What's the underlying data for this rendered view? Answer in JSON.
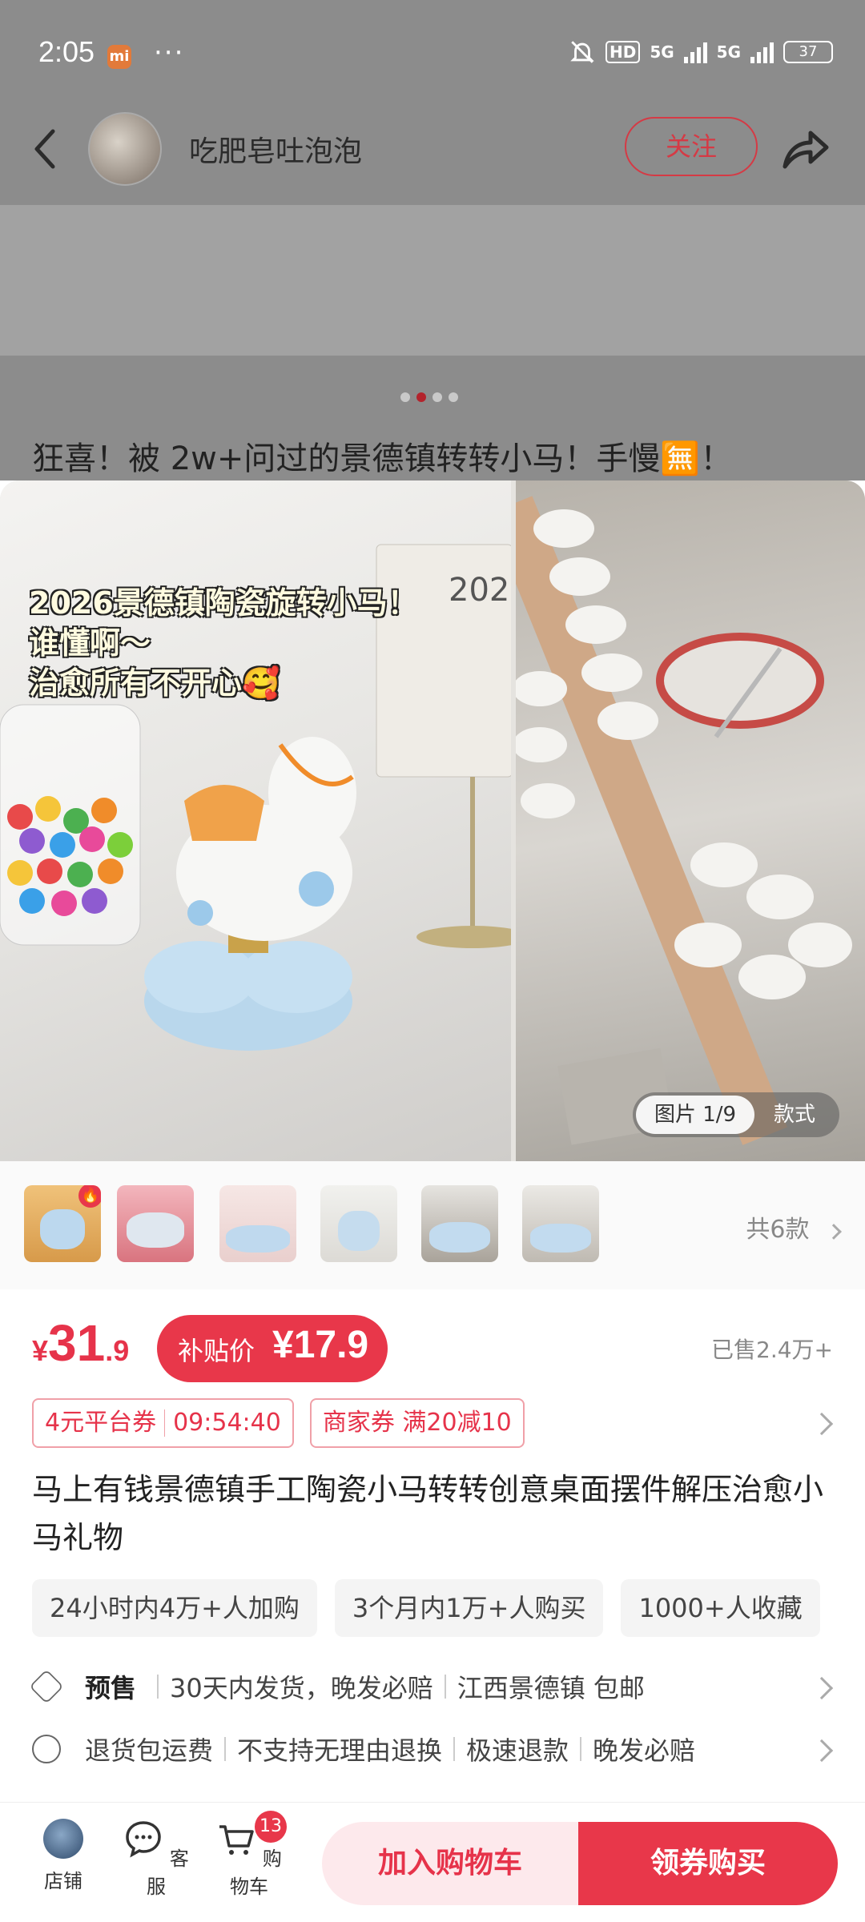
{
  "status_bar": {
    "time": "2:05",
    "carrier_badge": "mi",
    "more": "···",
    "hd": "HD",
    "network_1": "5G",
    "network_2": "5G",
    "battery": "37"
  },
  "header": {
    "author": "吃肥皂吐泡泡",
    "follow_label": "关注"
  },
  "post": {
    "title": "狂喜！被 2w+问过的景德镇转转小马！手慢🈚！"
  },
  "gallery": {
    "overlay_lines": [
      "2026景德镇陶瓷旋转小马！",
      "谁懂啊～",
      "治愈所有不开心🥰"
    ],
    "image_counter": "图片 1/9",
    "style_label": "款式"
  },
  "thumbnails": {
    "count": 6,
    "variants_label": "共6款"
  },
  "price": {
    "currency": "¥",
    "integer": "31",
    "decimal": ".9",
    "subsidy_label": "补贴价",
    "subsidy_value": "¥17.9",
    "sold": "已售2.4万+"
  },
  "coupons": [
    {
      "label": "4元平台券",
      "timer": "09:54:40"
    },
    {
      "label": "商家券 满20减10"
    }
  ],
  "product": {
    "title": "马上有钱景德镇手工陶瓷小马转转创意桌面摆件解压治愈小马礼物",
    "tags": [
      "24小时内4万+人加购",
      "3个月内1万+人购买",
      "1000+人收藏"
    ]
  },
  "shipping": {
    "presale_label": "预售",
    "presale_detail": "30天内发货，晚发必赔",
    "origin": "江西景德镇 包邮",
    "guarantees": [
      "退货包运费",
      "不支持无理由退换",
      "极速退款",
      "晚发必赔"
    ]
  },
  "bottom_bar": {
    "store": "店铺",
    "service": "客服",
    "cart": "购物车",
    "cart_count": "13",
    "add_to_cart": "加入购物车",
    "buy_now": "领券购买"
  },
  "colors": {
    "accent": "#e8374a",
    "price": "#e6334a"
  }
}
